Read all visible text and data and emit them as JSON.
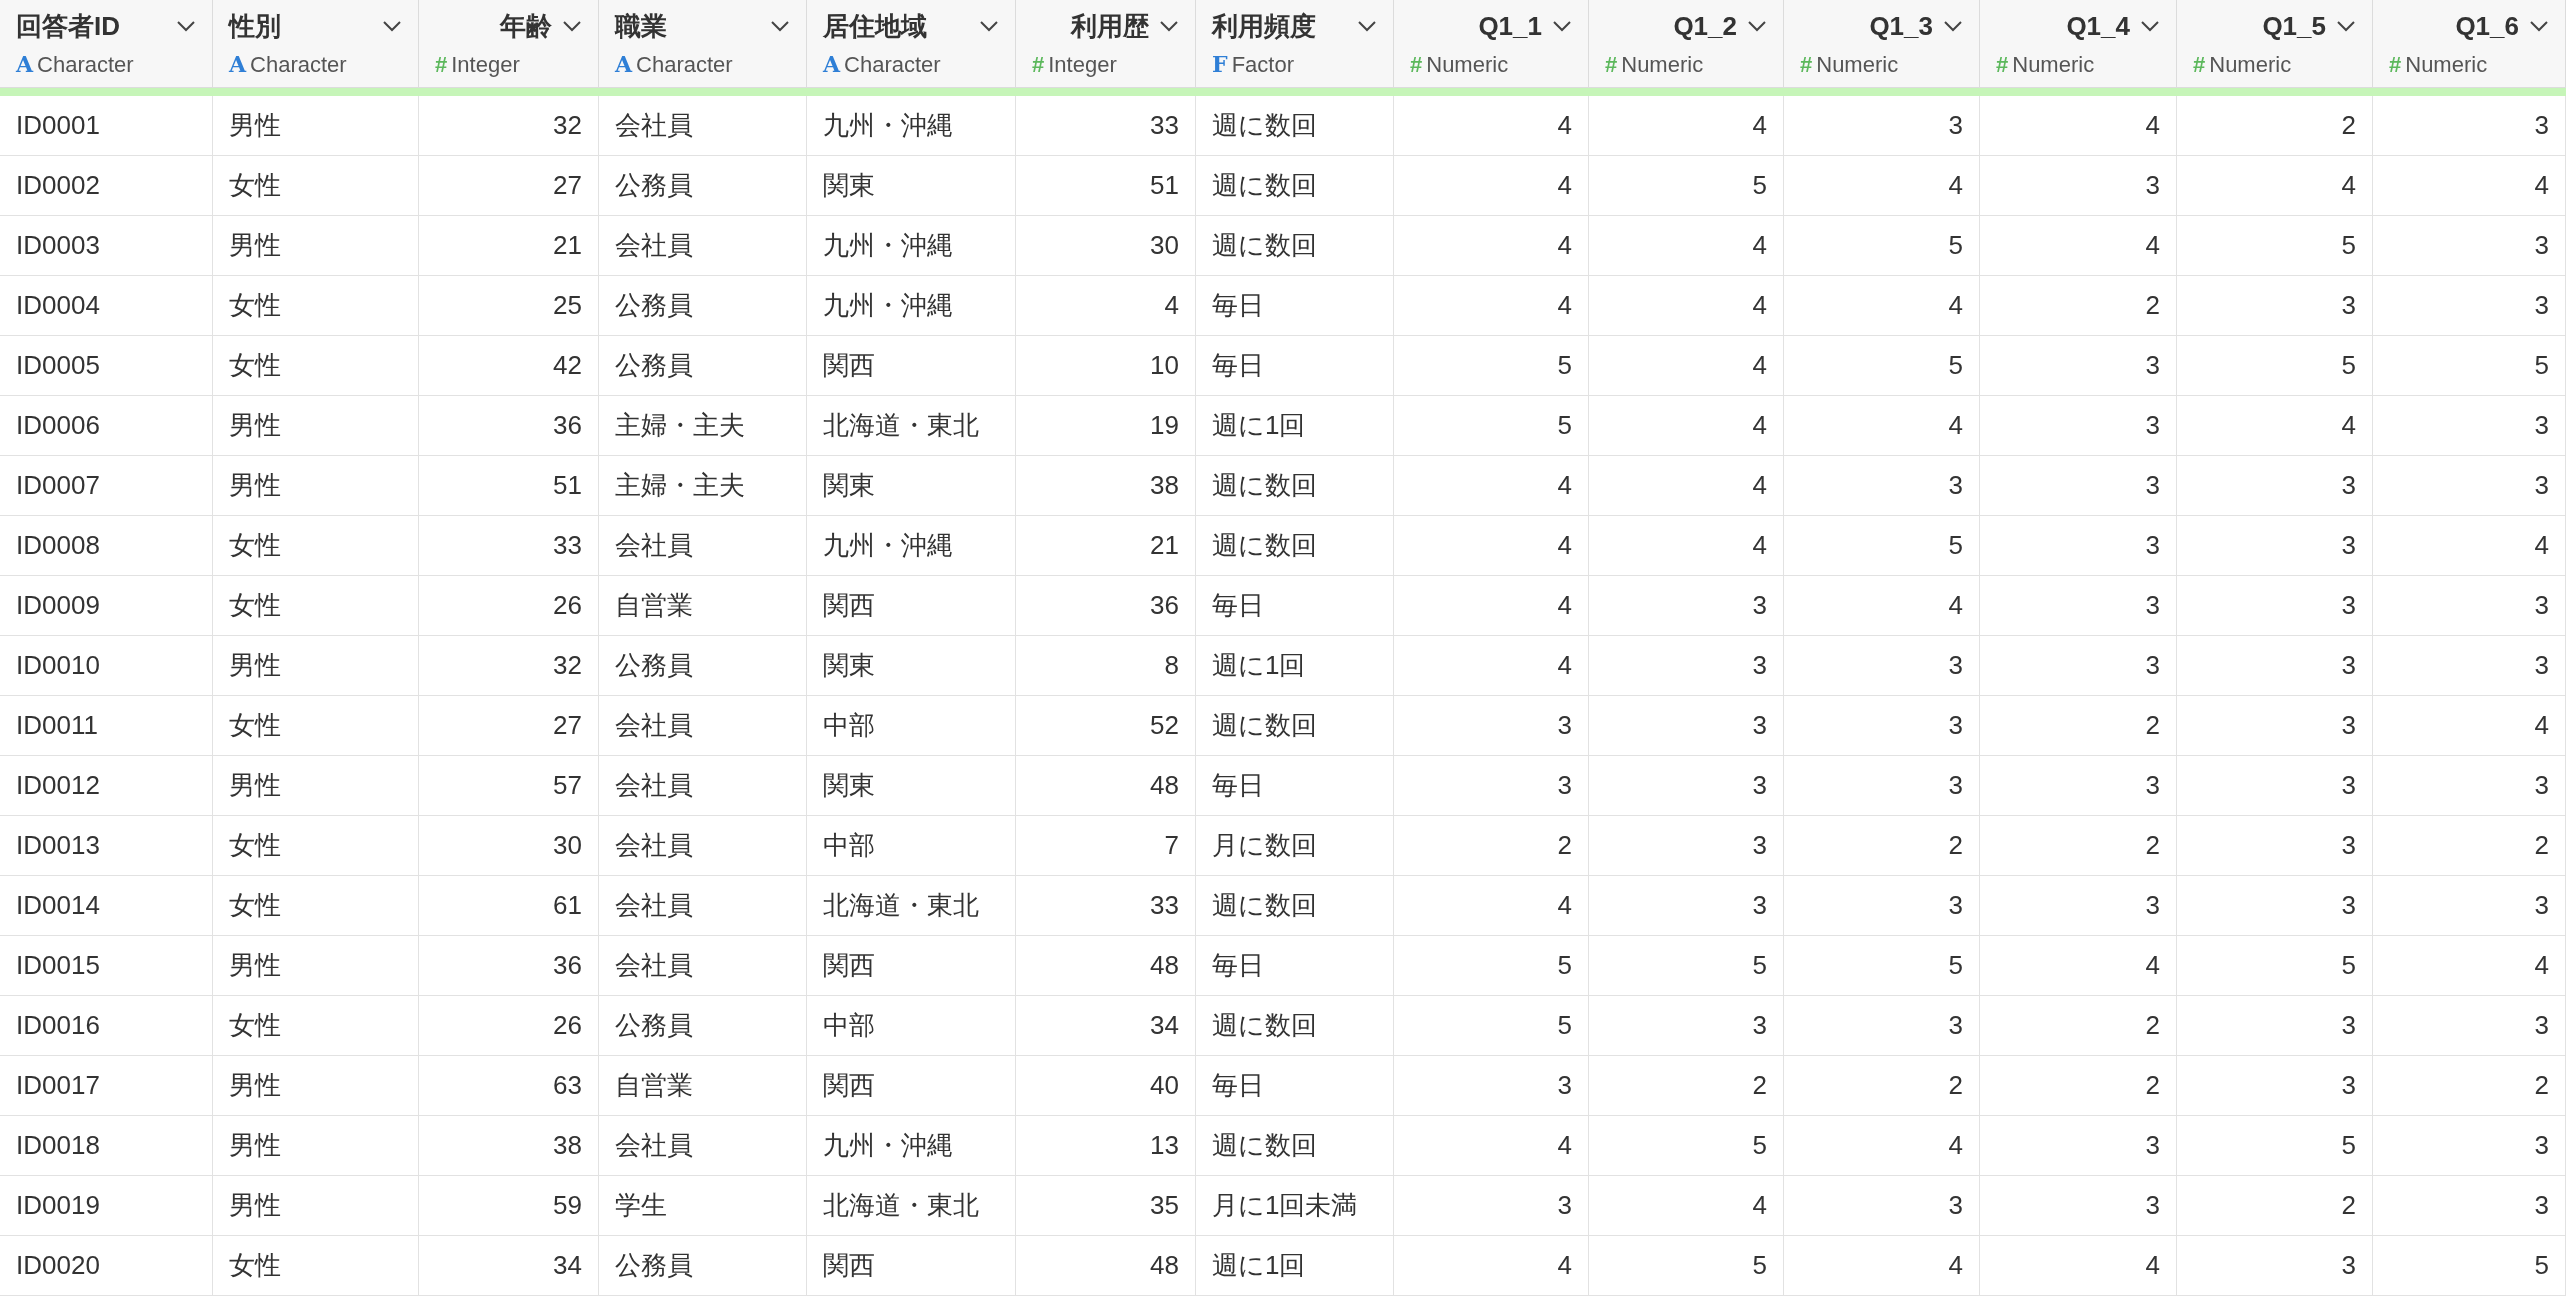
{
  "columns": [
    {
      "name": "回答者ID",
      "kind": "text",
      "type_icon": "A",
      "type": "Character"
    },
    {
      "name": "性別",
      "kind": "text",
      "type_icon": "A",
      "type": "Character"
    },
    {
      "name": "年齢",
      "kind": "number",
      "type_icon": "#",
      "type": "Integer"
    },
    {
      "name": "職業",
      "kind": "text",
      "type_icon": "A",
      "type": "Character"
    },
    {
      "name": "居住地域",
      "kind": "text",
      "type_icon": "A",
      "type": "Character"
    },
    {
      "name": "利用歴",
      "kind": "number",
      "type_icon": "#",
      "type": "Integer"
    },
    {
      "name": "利用頻度",
      "kind": "factor",
      "type_icon": "F",
      "type": "Factor"
    },
    {
      "name": "Q1_1",
      "kind": "number",
      "type_icon": "#",
      "type": "Numeric"
    },
    {
      "name": "Q1_2",
      "kind": "number",
      "type_icon": "#",
      "type": "Numeric"
    },
    {
      "name": "Q1_3",
      "kind": "number",
      "type_icon": "#",
      "type": "Numeric"
    },
    {
      "name": "Q1_4",
      "kind": "number",
      "type_icon": "#",
      "type": "Numeric"
    },
    {
      "name": "Q1_5",
      "kind": "number",
      "type_icon": "#",
      "type": "Numeric"
    },
    {
      "name": "Q1_6",
      "kind": "number",
      "type_icon": "#",
      "type": "Numeric"
    }
  ],
  "rows": [
    [
      "ID0001",
      "男性",
      "32",
      "会社員",
      "九州・沖縄",
      "33",
      "週に数回",
      "4",
      "4",
      "3",
      "4",
      "2",
      "3"
    ],
    [
      "ID0002",
      "女性",
      "27",
      "公務員",
      "関東",
      "51",
      "週に数回",
      "4",
      "5",
      "4",
      "3",
      "4",
      "4"
    ],
    [
      "ID0003",
      "男性",
      "21",
      "会社員",
      "九州・沖縄",
      "30",
      "週に数回",
      "4",
      "4",
      "5",
      "4",
      "5",
      "3"
    ],
    [
      "ID0004",
      "女性",
      "25",
      "公務員",
      "九州・沖縄",
      "4",
      "毎日",
      "4",
      "4",
      "4",
      "2",
      "3",
      "3"
    ],
    [
      "ID0005",
      "女性",
      "42",
      "公務員",
      "関西",
      "10",
      "毎日",
      "5",
      "4",
      "5",
      "3",
      "5",
      "5"
    ],
    [
      "ID0006",
      "男性",
      "36",
      "主婦・主夫",
      "北海道・東北",
      "19",
      "週に1回",
      "5",
      "4",
      "4",
      "3",
      "4",
      "3"
    ],
    [
      "ID0007",
      "男性",
      "51",
      "主婦・主夫",
      "関東",
      "38",
      "週に数回",
      "4",
      "4",
      "3",
      "3",
      "3",
      "3"
    ],
    [
      "ID0008",
      "女性",
      "33",
      "会社員",
      "九州・沖縄",
      "21",
      "週に数回",
      "4",
      "4",
      "5",
      "3",
      "3",
      "4"
    ],
    [
      "ID0009",
      "女性",
      "26",
      "自営業",
      "関西",
      "36",
      "毎日",
      "4",
      "3",
      "4",
      "3",
      "3",
      "3"
    ],
    [
      "ID0010",
      "男性",
      "32",
      "公務員",
      "関東",
      "8",
      "週に1回",
      "4",
      "3",
      "3",
      "3",
      "3",
      "3"
    ],
    [
      "ID0011",
      "女性",
      "27",
      "会社員",
      "中部",
      "52",
      "週に数回",
      "3",
      "3",
      "3",
      "2",
      "3",
      "4"
    ],
    [
      "ID0012",
      "男性",
      "57",
      "会社員",
      "関東",
      "48",
      "毎日",
      "3",
      "3",
      "3",
      "3",
      "3",
      "3"
    ],
    [
      "ID0013",
      "女性",
      "30",
      "会社員",
      "中部",
      "7",
      "月に数回",
      "2",
      "3",
      "2",
      "2",
      "3",
      "2"
    ],
    [
      "ID0014",
      "女性",
      "61",
      "会社員",
      "北海道・東北",
      "33",
      "週に数回",
      "4",
      "3",
      "3",
      "3",
      "3",
      "3"
    ],
    [
      "ID0015",
      "男性",
      "36",
      "会社員",
      "関西",
      "48",
      "毎日",
      "5",
      "5",
      "5",
      "4",
      "5",
      "4"
    ],
    [
      "ID0016",
      "女性",
      "26",
      "公務員",
      "中部",
      "34",
      "週に数回",
      "5",
      "3",
      "3",
      "2",
      "3",
      "3"
    ],
    [
      "ID0017",
      "男性",
      "63",
      "自営業",
      "関西",
      "40",
      "毎日",
      "3",
      "2",
      "2",
      "2",
      "3",
      "2"
    ],
    [
      "ID0018",
      "男性",
      "38",
      "会社員",
      "九州・沖縄",
      "13",
      "週に数回",
      "4",
      "5",
      "4",
      "3",
      "5",
      "3"
    ],
    [
      "ID0019",
      "男性",
      "59",
      "学生",
      "北海道・東北",
      "35",
      "月に1回未満",
      "3",
      "4",
      "3",
      "3",
      "2",
      "3"
    ],
    [
      "ID0020",
      "女性",
      "34",
      "公務員",
      "関西",
      "48",
      "週に1回",
      "4",
      "5",
      "4",
      "4",
      "3",
      "5"
    ]
  ]
}
